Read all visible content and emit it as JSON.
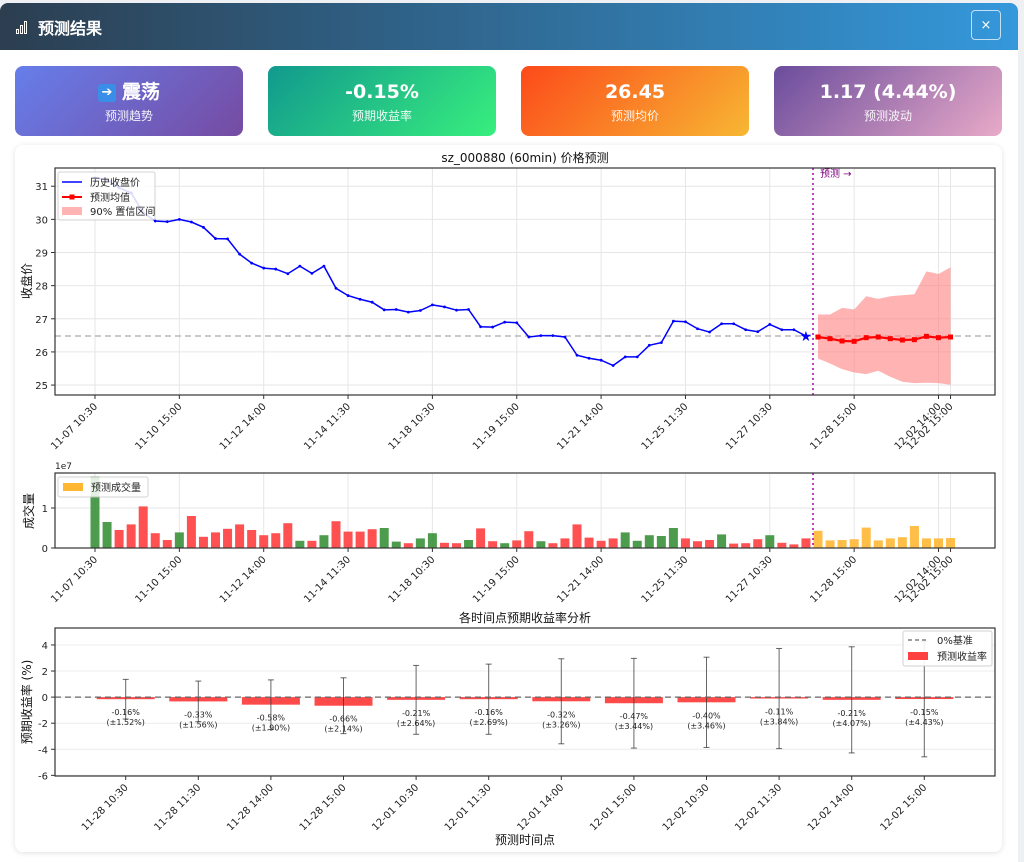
{
  "header": {
    "title": "预测结果",
    "close_label": "×"
  },
  "cards": [
    {
      "value": "震荡",
      "label": "预测趋势",
      "icon": "right-arrow-icon"
    },
    {
      "value": "-0.15%",
      "label": "预期收益率"
    },
    {
      "value": "26.45",
      "label": "预测均价"
    },
    {
      "value": "1.17 (4.44%)",
      "label": "预测波动"
    }
  ],
  "chart_data": [
    {
      "type": "line",
      "title": "sz_000880 (60min) 价格预测",
      "ylabel": "收盘价",
      "ylim": [
        24.7,
        31.55
      ],
      "yticks": [
        25,
        26,
        27,
        28,
        29,
        30,
        31
      ],
      "xtick_labels": [
        "11-07 10:30",
        "11-10 15:00",
        "11-12 14:00",
        "11-14 11:30",
        "11-18 10:30",
        "11-19 15:00",
        "11-21 14:00",
        "11-25 11:30",
        "11-27 10:30",
        "11-28 15:00",
        "12-02 14:00",
        "12-02 15:00"
      ],
      "xtick_index": [
        0,
        7,
        14,
        21,
        28,
        35,
        42,
        49,
        56,
        63,
        70,
        71
      ],
      "reference_line": 26.48,
      "forecast_marker": "预测 →",
      "grid": true,
      "legend": "top-left",
      "colors": {
        "history": "#0000ff",
        "forecast": "#ff0000",
        "band": "#ff8080",
        "divider": "#b000b0"
      },
      "series": [
        {
          "name": "历史收盘价",
          "start_index": 0,
          "values": [
            31.25,
            31.2,
            30.95,
            30.8,
            30.2,
            29.95,
            29.93,
            30.0,
            29.92,
            29.76,
            29.42,
            29.41,
            28.95,
            28.68,
            28.53,
            28.5,
            28.36,
            28.59,
            28.37,
            28.59,
            27.92,
            27.7,
            27.59,
            27.5,
            27.27,
            27.28,
            27.2,
            27.25,
            27.42,
            27.36,
            27.26,
            27.28,
            26.76,
            26.75,
            26.9,
            26.88,
            26.45,
            26.49,
            26.49,
            26.45,
            25.9,
            25.81,
            25.75,
            25.59,
            25.85,
            25.85,
            26.2,
            26.28,
            26.93,
            26.91,
            26.7,
            26.6,
            26.85,
            26.85,
            26.67,
            26.61,
            26.83,
            26.67,
            26.67,
            26.48
          ]
        },
        {
          "name": "预测均值",
          "start_index": 60,
          "values": [
            26.45,
            26.4,
            26.33,
            26.32,
            26.43,
            26.45,
            26.4,
            26.36,
            26.37,
            26.47,
            26.43,
            26.45
          ]
        },
        {
          "name": "90% 置信区间",
          "start_index": 60,
          "upper": [
            27.13,
            27.13,
            27.33,
            27.28,
            27.68,
            27.6,
            27.68,
            27.71,
            27.74,
            28.43,
            28.35,
            28.55
          ],
          "lower": [
            25.8,
            25.65,
            25.48,
            25.38,
            25.33,
            25.43,
            25.25,
            25.1,
            25.06,
            25.07,
            25.06,
            25.01
          ]
        }
      ]
    },
    {
      "type": "bar",
      "ylabel": "成交量",
      "offset_label": "1e7",
      "ylim": [
        0,
        1.875
      ],
      "yticks": [
        0,
        1
      ],
      "grid": true,
      "legend": "top-left",
      "colors": {
        "up": "#ff3333",
        "down": "#2e8b2e",
        "forecast": "#ffb733"
      },
      "history": {
        "values": [
          1.79,
          0.65,
          0.45,
          0.59,
          1.04,
          0.37,
          0.2,
          0.39,
          0.8,
          0.28,
          0.39,
          0.48,
          0.59,
          0.45,
          0.32,
          0.37,
          0.62,
          0.18,
          0.18,
          0.32,
          0.67,
          0.41,
          0.41,
          0.47,
          0.5,
          0.16,
          0.12,
          0.24,
          0.37,
          0.13,
          0.12,
          0.2,
          0.49,
          0.17,
          0.12,
          0.19,
          0.42,
          0.17,
          0.12,
          0.24,
          0.59,
          0.26,
          0.18,
          0.24,
          0.39,
          0.18,
          0.32,
          0.3,
          0.5,
          0.24,
          0.17,
          0.2,
          0.34,
          0.11,
          0.12,
          0.22,
          0.32,
          0.13,
          0.09,
          0.24
        ],
        "direction": [
          "down",
          "down",
          "up",
          "up",
          "up",
          "up",
          "up",
          "down",
          "up",
          "up",
          "up",
          "up",
          "up",
          "up",
          "up",
          "up",
          "up",
          "down",
          "up",
          "down",
          "up",
          "up",
          "up",
          "up",
          "down",
          "down",
          "up",
          "down",
          "down",
          "up",
          "up",
          "down",
          "up",
          "up",
          "down",
          "up",
          "up",
          "down",
          "up",
          "up",
          "up",
          "up",
          "up",
          "up",
          "down",
          "down",
          "down",
          "down",
          "down",
          "up",
          "up",
          "up",
          "down",
          "up",
          "up",
          "up",
          "down",
          "up",
          "up",
          "up"
        ]
      },
      "series": [
        {
          "name": "预测成交量",
          "start_index": 60,
          "values": [
            0.43,
            0.19,
            0.2,
            0.22,
            0.51,
            0.19,
            0.24,
            0.27,
            0.55,
            0.24,
            0.24,
            0.25
          ]
        }
      ]
    },
    {
      "type": "bar",
      "title": "各时间点预期收益率分析",
      "xlabel": "预测时间点",
      "ylabel": "预期收益率 (%)",
      "ylim": [
        -6.05,
        5.3
      ],
      "yticks": [
        4,
        2,
        0,
        -2,
        -4,
        -6
      ],
      "legend": "top-right",
      "baseline_label": "0%基准",
      "colors": {
        "bar": "#ff4040",
        "baseline": "#666666",
        "errorbar": "#333333"
      },
      "categories": [
        "11-28 10:30",
        "11-28 11:30",
        "11-28 14:00",
        "11-28 15:00",
        "12-01 10:30",
        "12-01 11:30",
        "12-01 14:00",
        "12-01 15:00",
        "12-02 10:30",
        "12-02 11:30",
        "12-02 14:00",
        "12-02 15:00"
      ],
      "series": [
        {
          "name": "预测收益率",
          "values": [
            -0.16,
            -0.33,
            -0.58,
            -0.66,
            -0.21,
            -0.16,
            -0.32,
            -0.47,
            -0.4,
            -0.11,
            -0.21,
            -0.15
          ],
          "errors": [
            1.52,
            1.56,
            1.9,
            2.14,
            2.64,
            2.69,
            3.26,
            3.44,
            3.46,
            3.84,
            4.07,
            4.43
          ]
        }
      ],
      "data_labels": [
        "-0.16%\n(±1.52%)",
        "-0.33%\n(±1.56%)",
        "-0.58%\n(±1.90%)",
        "-0.66%\n(±2.14%)",
        "-0.21%\n(±2.64%)",
        "-0.16%\n(±2.69%)",
        "-0.32%\n(±3.26%)",
        "-0.47%\n(±3.44%)",
        "-0.40%\n(±3.46%)",
        "-0.11%\n(±3.84%)",
        "-0.21%\n(±4.07%)",
        "-0.15%\n(±4.43%)"
      ]
    }
  ]
}
